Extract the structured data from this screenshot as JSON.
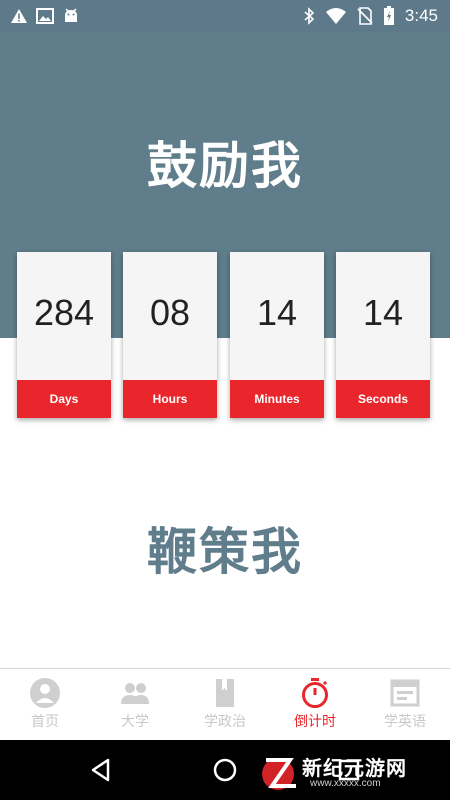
{
  "status_bar": {
    "time": "3:45",
    "left_icons": [
      "warning-icon",
      "image-icon",
      "android-icon"
    ],
    "right_icons": [
      "bluetooth-icon",
      "wifi-icon",
      "no-sim-icon",
      "battery-icon"
    ]
  },
  "hero": {
    "title": "鼓励我",
    "background_color": "#607d8b"
  },
  "countdown": [
    {
      "value": "284",
      "label": "Days"
    },
    {
      "value": "08",
      "label": "Hours"
    },
    {
      "value": "14",
      "label": "Minutes"
    },
    {
      "value": "14",
      "label": "Seconds"
    }
  ],
  "accent_color": "#e8262b",
  "subtitle": "鞭策我",
  "tabs": [
    {
      "label": "首页",
      "icon": "person-icon",
      "active": false
    },
    {
      "label": "大学",
      "icon": "group-icon",
      "active": false
    },
    {
      "label": "学政治",
      "icon": "book-icon",
      "active": false
    },
    {
      "label": "倒计时",
      "icon": "stopwatch-icon",
      "active": true
    },
    {
      "label": "学英语",
      "icon": "calendar-icon",
      "active": false
    }
  ],
  "nav_bar": [
    "back-icon",
    "home-icon",
    "recents-icon"
  ],
  "watermark": {
    "text": "新纪元游网",
    "url": "www.xxxxx.com"
  }
}
